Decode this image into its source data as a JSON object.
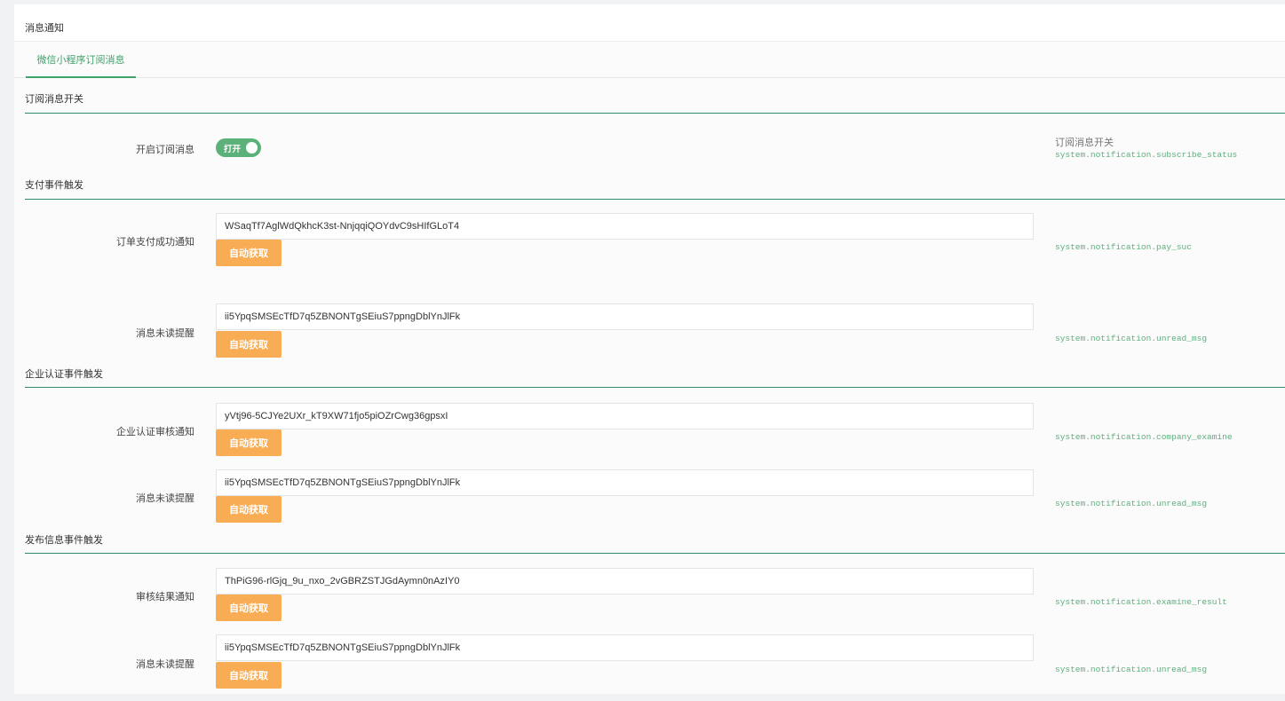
{
  "header": {
    "title": "消息通知"
  },
  "tabs": [
    {
      "label": "微信小程序订阅消息"
    }
  ],
  "sections": {
    "subscribe": {
      "title": "订阅消息开关",
      "label": "开启订阅消息",
      "toggle_text": "打开",
      "toggle_on": true,
      "hint_title": "订阅消息开关",
      "hint": "system.notification.subscribe_status"
    },
    "pay": {
      "title": "支付事件触发",
      "fields": [
        {
          "label": "订单支付成功通知",
          "value": "WSaqTf7AglWdQkhcK3st-NnjqqiQOYdvC9sHIfGLoT4",
          "button": "自动获取",
          "hint": "system.notification.pay_suc"
        },
        {
          "label": "消息未读提醒",
          "value": "ii5YpqSMSEcTfD7q5ZBNONTgSEiuS7ppngDblYnJlFk",
          "button": "自动获取",
          "hint": "system.notification.unread_msg"
        }
      ]
    },
    "company": {
      "title": "企业认证事件触发",
      "fields": [
        {
          "label": "企业认证审核通知",
          "value": "yVtj96-5CJYe2UXr_kT9XW71fjo5piOZrCwg36gpsxI",
          "button": "自动获取",
          "hint": "system.notification.company_examine"
        },
        {
          "label": "消息未读提醒",
          "value": "ii5YpqSMSEcTfD7q5ZBNONTgSEiuS7ppngDblYnJlFk",
          "button": "自动获取",
          "hint": "system.notification.unread_msg"
        }
      ]
    },
    "publish": {
      "title": "发布信息事件触发",
      "fields": [
        {
          "label": "审核结果通知",
          "value": "ThPiG96-rlGjq_9u_nxo_2vGBRZSTJGdAymn0nAzIY0",
          "button": "自动获取",
          "hint": "system.notification.examine_result"
        },
        {
          "label": "消息未读提醒",
          "value": "ii5YpqSMSEcTfD7q5ZBNONTgSEiuS7ppngDblYnJlFk",
          "button": "自动获取",
          "hint": "system.notification.unread_msg"
        }
      ]
    }
  },
  "colors": {
    "accent": "#3fa36a",
    "button": "#f8ad55",
    "toggle": "#5cb07a",
    "hint": "#5eae7e"
  }
}
